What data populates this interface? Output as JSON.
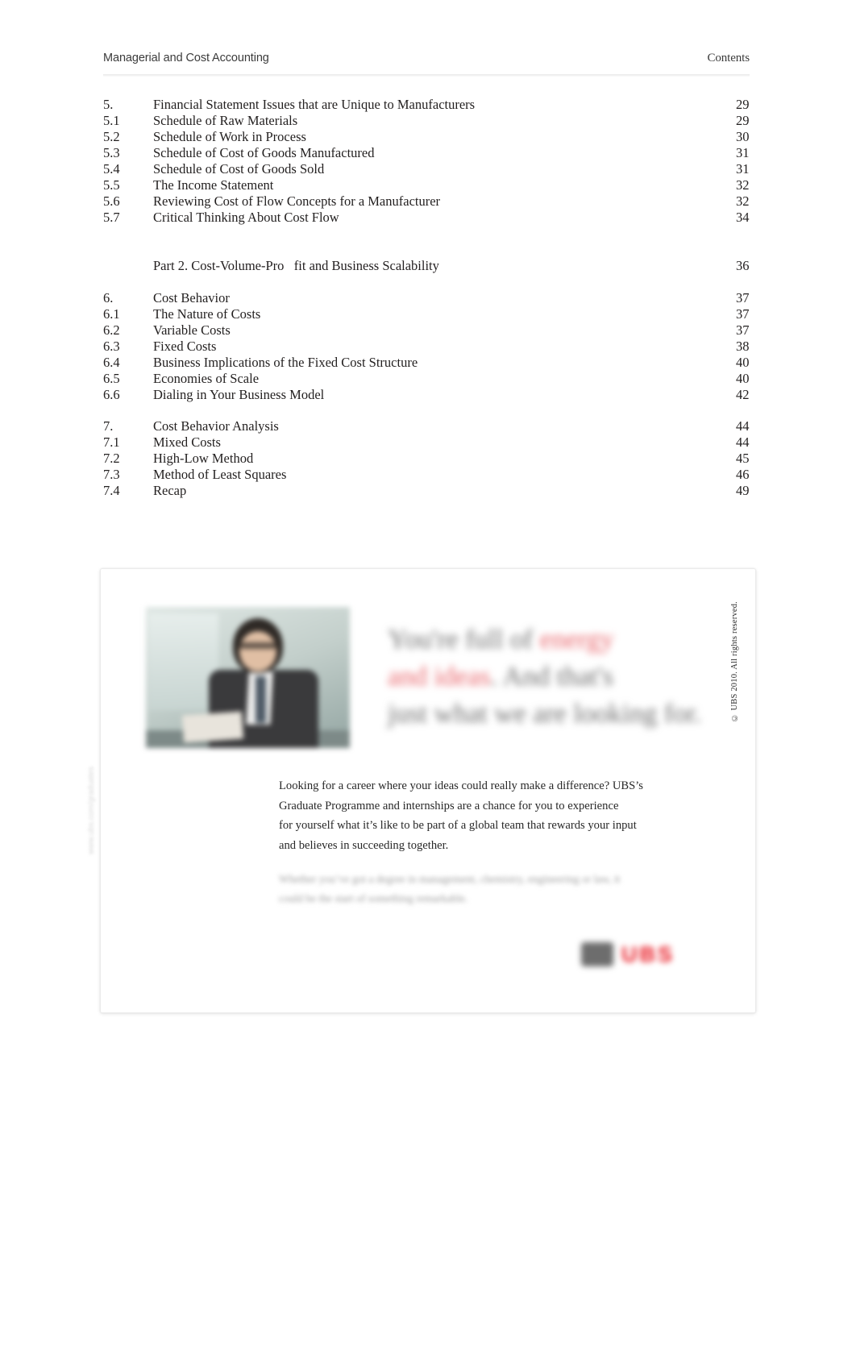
{
  "header": {
    "left_title": "Managerial and Cost Accounting",
    "right_title": "Contents"
  },
  "toc": {
    "groups": [
      {
        "id": "section-5",
        "rows": [
          {
            "num": "5.",
            "title": "Financial Statement Issues that are Unique to Manufacturers",
            "page": "29"
          },
          {
            "num": "5.1",
            "title": "Schedule of Raw Materials",
            "page": "29"
          },
          {
            "num": "5.2",
            "title": "Schedule of Work in Process",
            "page": "30"
          },
          {
            "num": "5.3",
            "title": "Schedule of Cost of Goods Manufactured",
            "page": "31"
          },
          {
            "num": "5.4",
            "title": "Schedule of Cost of Goods Sold",
            "page": "31"
          },
          {
            "num": "5.5",
            "title": "The Income Statement",
            "page": "32"
          },
          {
            "num": "5.6",
            "title": "Reviewing Cost of Flow Concepts for a Manufacturer",
            "page": "32"
          },
          {
            "num": "5.7",
            "title": "Critical Thinking About Cost Flow",
            "page": "34"
          }
        ]
      },
      {
        "id": "part-2",
        "part": {
          "num": "",
          "title": "Part 2. Cost-Volume-Pro   fit and Business Scalability",
          "page": "36"
        }
      },
      {
        "id": "section-6",
        "rows": [
          {
            "num": "6.",
            "title": "Cost Behavior",
            "page": "37"
          },
          {
            "num": "6.1",
            "title": "The Nature of Costs",
            "page": "37"
          },
          {
            "num": "6.2",
            "title": "Variable Costs",
            "page": "37"
          },
          {
            "num": "6.3",
            "title": "Fixed Costs",
            "page": "38"
          },
          {
            "num": "6.4",
            "title": "Business Implications of the Fixed Cost Structure",
            "page": "40"
          },
          {
            "num": "6.5",
            "title": "Economies of Scale",
            "page": "40"
          },
          {
            "num": "6.6",
            "title": "Dialing in Your Business Model",
            "page": "42"
          }
        ]
      },
      {
        "id": "section-7",
        "rows": [
          {
            "num": "7.",
            "title": "Cost Behavior Analysis",
            "page": "44"
          },
          {
            "num": "7.1",
            "title": "Mixed Costs",
            "page": "44"
          },
          {
            "num": "7.2",
            "title": "High-Low Method",
            "page": "45"
          },
          {
            "num": "7.3",
            "title": "Method of Least Squares",
            "page": "46"
          },
          {
            "num": "7.4",
            "title": "Recap",
            "page": "49"
          }
        ]
      }
    ]
  },
  "ad": {
    "headline": {
      "line1_plain": "You're full of ",
      "line1_accent": "energy",
      "line2_accent": "and ideas",
      "line2_plain": ". And that's",
      "line3": "just what we are looking for."
    },
    "body": {
      "line1": "Looking for a career where your ideas could really make a difference? UBS’s",
      "line2": "Graduate Programme and internships are a chance for you to experience",
      "line3": "for yourself what it’s like to be part of a global team that rewards your input",
      "line4": "and believes in succeeding together."
    },
    "subcopy": {
      "line1": "Whether you’ve got a degree in management, chemistry, engineering or law, it",
      "line2": "could be the start of something remarkable."
    },
    "logo_text": "UBS",
    "copyright": "© UBS 2010. All rights reserved.",
    "margin_marks": "www.ubs.com/graduates"
  },
  "colors": {
    "accent_red": "#e8656b",
    "logo_red": "#e8131d",
    "text": "#231f20",
    "muted": "#9b9b9b"
  }
}
